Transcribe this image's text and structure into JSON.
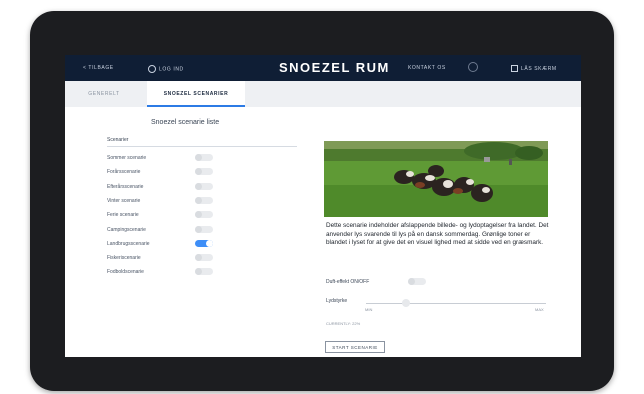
{
  "topbar": {
    "back": "< TILBAGE",
    "login": "LOG IND",
    "title": "SNOEZEL RUM",
    "contact": "KONTAKT OS",
    "lock": "LÅS SKÆRM"
  },
  "tabs": [
    {
      "label": "GENERELT"
    },
    {
      "label": "SNOEZEL SCENARIER"
    }
  ],
  "left": {
    "title": "Snoezel scenarie liste",
    "section_label": "Scenarier",
    "items": [
      {
        "label": "Sommer scenarie",
        "on": false
      },
      {
        "label": "Forårsscenarie",
        "on": false
      },
      {
        "label": "Efterårsscenarie",
        "on": false
      },
      {
        "label": "Vinter scenarie",
        "on": false
      },
      {
        "label": "Ferie scenarie",
        "on": false
      },
      {
        "label": "Campingscenarie",
        "on": false
      },
      {
        "label": "Landbrugsscenarie",
        "on": true
      },
      {
        "label": "Fiskeriscenarie",
        "on": false
      },
      {
        "label": "Fodboldscenarie",
        "on": false
      }
    ]
  },
  "right": {
    "image_alt": "Cows in a green field",
    "description": "Dette scenarie indeholder afslappende billede- og lydoptagelser fra landet. Det anvender lys svarende til lys på en dansk sommerdag. Grønlige toner er blandet i lyset for at give det en visuel lighed med at sidde ved en græsmark.",
    "scent_label": "Duft-effekt ON/OFF",
    "scent_on": false,
    "volume_label": "Lydstyrke",
    "volume_min": "MIN",
    "volume_max": "MAX",
    "volume_value": 0.22,
    "volume_status": "CURRENTLY: 22%",
    "start_button": "START SCENARIE"
  },
  "colors": {
    "topbar": "#0f1e35",
    "accent": "#3e8ef7"
  }
}
